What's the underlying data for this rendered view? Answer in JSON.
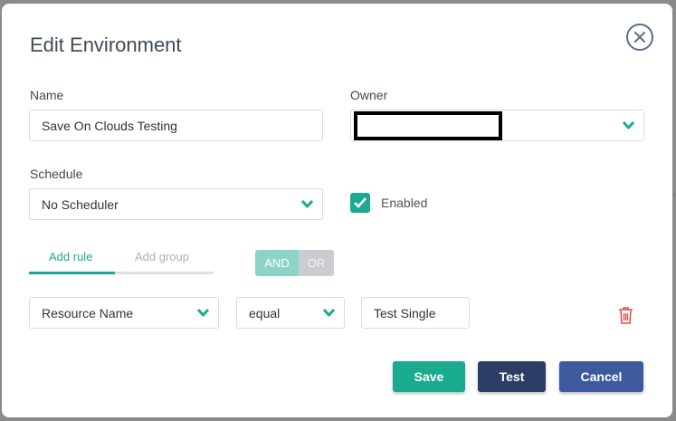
{
  "dialog": {
    "title": "Edit Environment"
  },
  "form": {
    "name_label": "Name",
    "name_value": "Save On Clouds Testing",
    "owner_label": "Owner",
    "owner_value": "",
    "schedule_label": "Schedule",
    "schedule_value": "No Scheduler",
    "enabled_label": "Enabled",
    "enabled_checked": true
  },
  "rules": {
    "tabs": [
      {
        "label": "Add rule",
        "active": true
      },
      {
        "label": "Add group",
        "active": false
      }
    ],
    "logic": [
      {
        "label": "AND",
        "active": true
      },
      {
        "label": "OR",
        "active": false
      }
    ],
    "row": {
      "field": "Resource Name",
      "operator": "equal",
      "value": "Test Single"
    }
  },
  "buttons": {
    "save": "Save",
    "test": "Test",
    "cancel": "Cancel"
  },
  "colors": {
    "accent": "#1aab8f",
    "test_button": "#2c3e66",
    "cancel_button": "#3d5a9e",
    "delete": "#d9534f"
  },
  "icons": [
    "close-icon",
    "chevron-down-icon",
    "check-icon",
    "trash-icon"
  ]
}
